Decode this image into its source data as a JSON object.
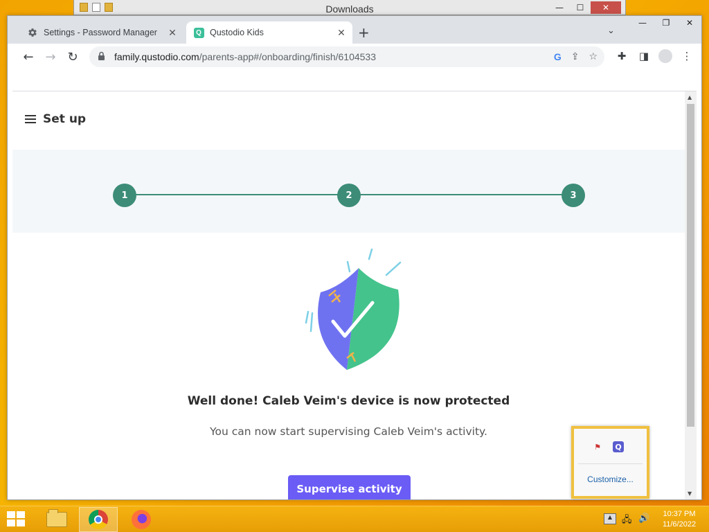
{
  "background_window": {
    "title": "Downloads"
  },
  "browser": {
    "tabs": [
      {
        "label": "Settings - Password Manager",
        "icon": "gear-icon"
      },
      {
        "label": "Qustodio Kids",
        "icon": "qustodio-icon",
        "favicon_letter": "Q"
      }
    ],
    "url": {
      "host": "family.qustodio.com",
      "path": "/parents-app#/onboarding/finish/6104533"
    }
  },
  "page": {
    "header_title": "Set up",
    "steps": [
      "1",
      "2",
      "3"
    ],
    "headline": "Well done! Caleb Veim's device is now protected",
    "subline": "You can now start supervising Caleb Veim's activity.",
    "cta_label": "Supervise activity",
    "colors": {
      "step": "#3c8c78",
      "cta": "#6a5cf5",
      "shield_left": "#6f72f0",
      "shield_right": "#44c38c"
    }
  },
  "tray_popup": {
    "customize_label": "Customize...",
    "qustodio_letter": "Q"
  },
  "taskbar": {
    "time": "10:37 PM",
    "date": "11/6/2022"
  }
}
